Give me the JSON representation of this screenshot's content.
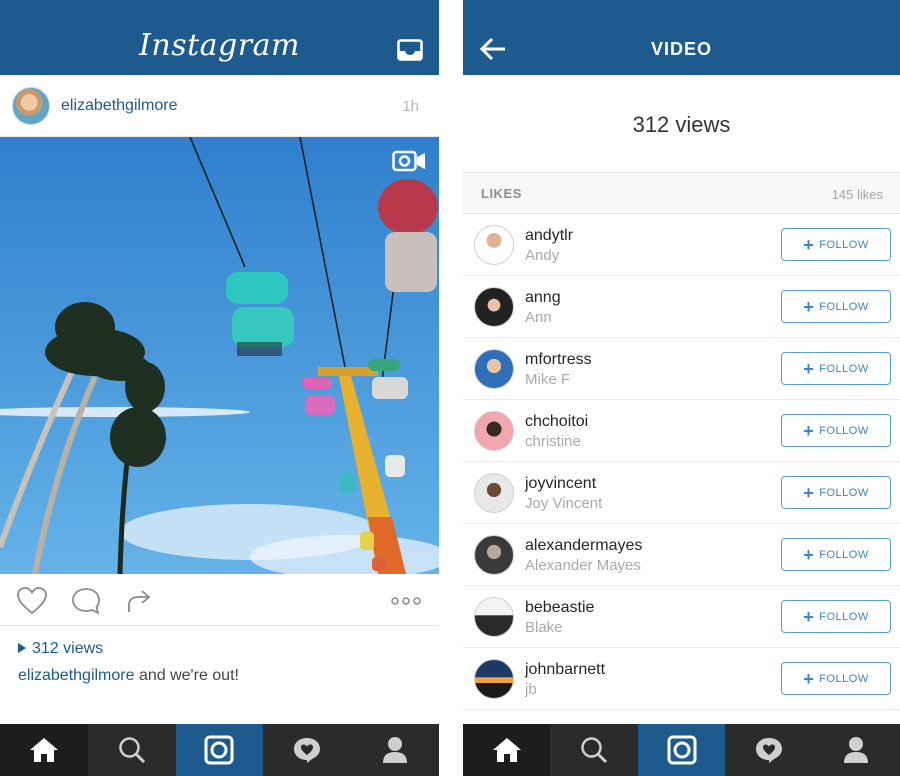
{
  "left_screen": {
    "brand": "Instagram",
    "post": {
      "username": "elizabethgilmore",
      "time": "1h",
      "views_label": "312 views",
      "caption_user": "elizabethgilmore",
      "caption_text": " and we're out!"
    }
  },
  "right_screen": {
    "title": "VIDEO",
    "views": "312 views",
    "likes_label": "LIKES",
    "likes_count": "145 likes",
    "follow_label": "FOLLOW",
    "users": [
      {
        "username": "andytlr",
        "name": "Andy"
      },
      {
        "username": "anng",
        "name": "Ann"
      },
      {
        "username": "mfortress",
        "name": "Mike F"
      },
      {
        "username": "chchoitoi",
        "name": "christine"
      },
      {
        "username": "joyvincent",
        "name": "Joy Vincent"
      },
      {
        "username": "alexandermayes",
        "name": "Alexander Mayes"
      },
      {
        "username": "bebeastie",
        "name": "Blake"
      },
      {
        "username": "johnbarnett",
        "name": "jb"
      }
    ]
  },
  "colors": {
    "header_blue": "#1d5b8f",
    "tabbar_dark": "#2b2b2b",
    "follow_blue": "#3b86c6"
  },
  "icons": {
    "top": [
      "inbox-icon",
      "back-arrow-icon"
    ],
    "actions": [
      "heart-icon",
      "comment-icon",
      "share-icon",
      "more-icon"
    ],
    "tabs": [
      "home-icon",
      "search-icon",
      "camera-icon",
      "activity-icon",
      "profile-icon"
    ]
  }
}
